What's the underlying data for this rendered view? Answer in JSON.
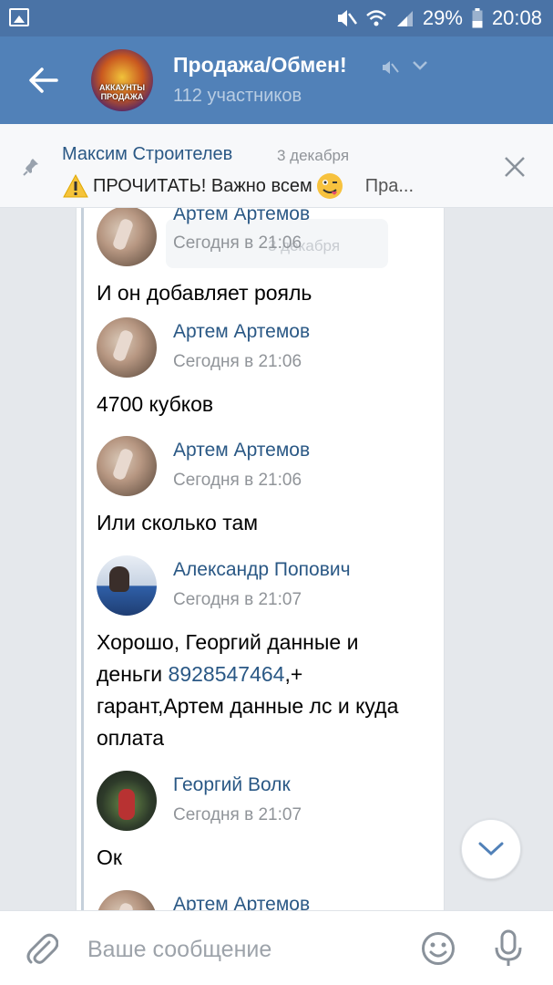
{
  "status_bar": {
    "battery": "29%",
    "time": "20:08",
    "icons": [
      "image-icon",
      "mute-icon",
      "wifi-icon",
      "signal-icon",
      "battery-icon"
    ]
  },
  "header": {
    "title": "Продажа/Обмен!",
    "subtitle": "112 участников",
    "avatar_text": "АККАУНТЫ ПРОДАЖА",
    "bg_color": "#5181b8"
  },
  "pinned": {
    "author": "Максим Строителев",
    "date": "3 декабря",
    "text": "ПРОЧИТАТЬ! Важно всем",
    "more": "Пра..."
  },
  "ghost_date": "3 декабря",
  "messages": [
    {
      "author": "Артем Артемов",
      "time": "Сегодня в 21:06",
      "text": "И он добавляет рояль",
      "avatar": "artem"
    },
    {
      "author": "Артем Артемов",
      "time": "Сегодня в 21:06",
      "text": "4700 кубков",
      "avatar": "artem"
    },
    {
      "author": "Артем Артемов",
      "time": "Сегодня в 21:06",
      "text": "Или сколько там",
      "avatar": "artem"
    },
    {
      "author": "Александр Попович",
      "time": "Сегодня в 21:07",
      "text_before": "Хорошо, Георгий данные и деньги ",
      "link": "8928547464",
      "text_after": ",+ гарант,Артем данные лс и куда оплата",
      "avatar": "alex"
    },
    {
      "author": "Георгий Волк",
      "time": "Сегодня в 21:07",
      "text": "Ок",
      "avatar": "georg"
    },
    {
      "author": "Артем Артемов",
      "avatar": "artem"
    }
  ],
  "compose": {
    "placeholder": "Ваше сообщение"
  },
  "colors": {
    "link": "#2a5885",
    "muted": "#909499",
    "header": "#5181b8",
    "statusbar": "#4a73a6"
  }
}
